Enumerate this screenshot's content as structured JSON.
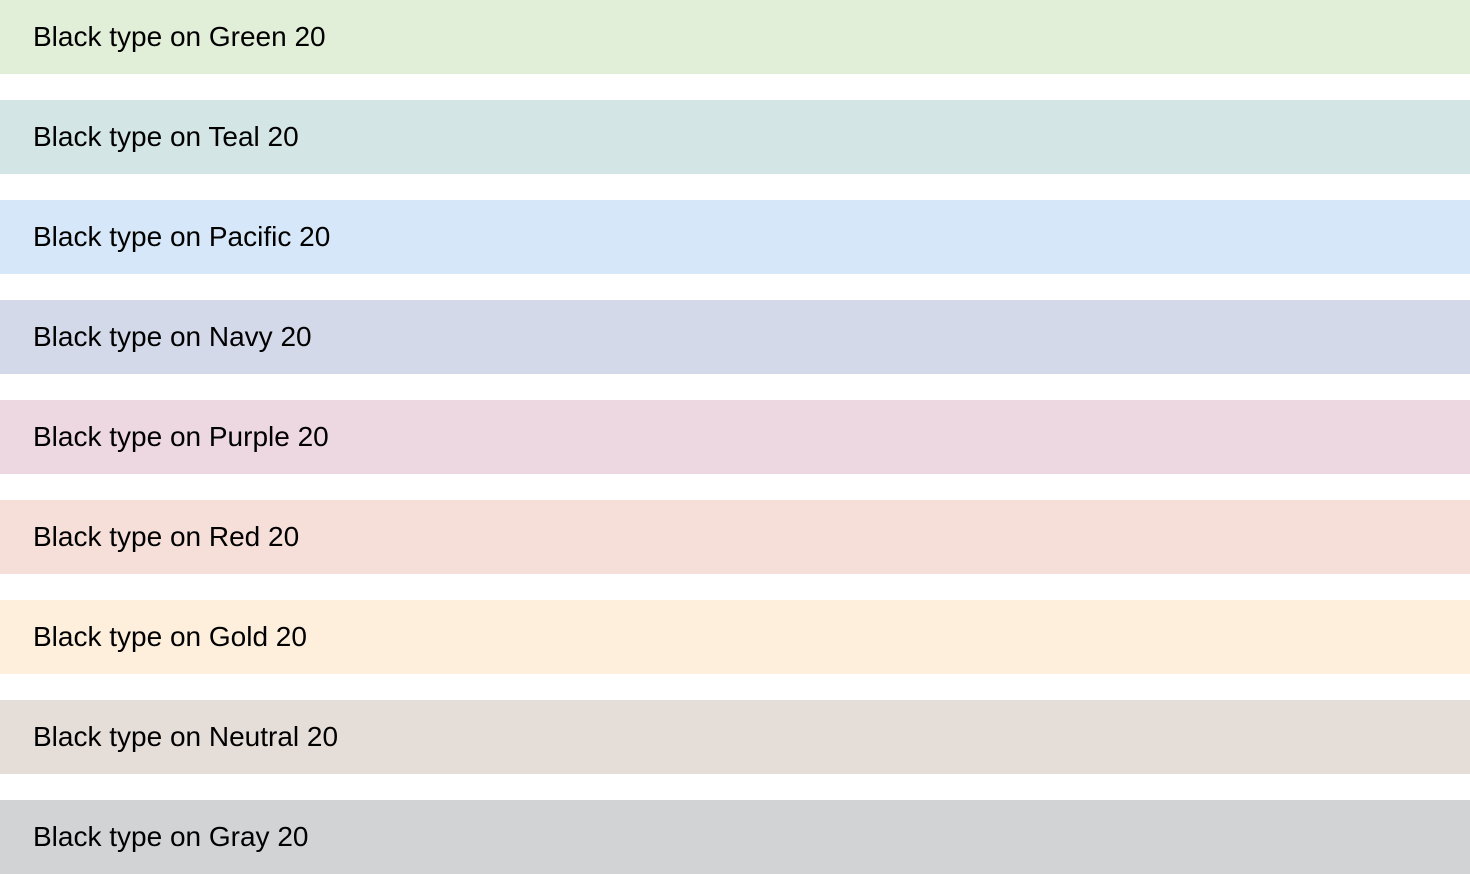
{
  "swatches": [
    {
      "label": "Black type on Green 20",
      "color": "#e1eed8"
    },
    {
      "label": "Black type on Teal 20",
      "color": "#d3e5e5"
    },
    {
      "label": "Black type on Pacific 20",
      "color": "#d5e7f8"
    },
    {
      "label": "Black type on Navy 20",
      "color": "#d4d9e9"
    },
    {
      "label": "Black type on Purple 20",
      "color": "#edd8e1"
    },
    {
      "label": "Black type on Red 20",
      "color": "#f6dfd8"
    },
    {
      "label": "Black type on Gold 20",
      "color": "#feefdd"
    },
    {
      "label": "Black type on Neutral 20",
      "color": "#e5ddd8"
    },
    {
      "label": "Black type on Gray 20",
      "color": "#d2d3d5"
    }
  ]
}
